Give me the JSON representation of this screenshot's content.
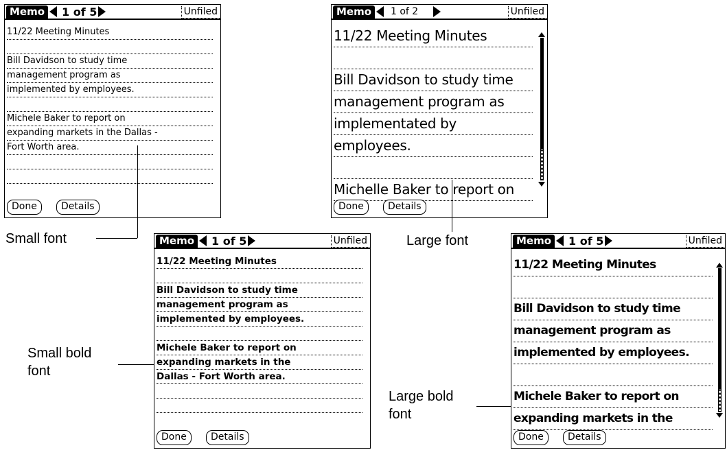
{
  "screens": {
    "small": {
      "title": "Memo",
      "page": "1 of 5",
      "category": "Unfiled",
      "lines": [
        "11/22 Meeting Minutes",
        "",
        "Bill Davidson to study time",
        "management program as",
        "implemented by employees.",
        "",
        "Michele Baker to report on",
        "expanding markets in the Dallas -",
        "Fort Worth area.",
        "",
        ""
      ],
      "done": "Done",
      "details": "Details"
    },
    "large": {
      "title": "Memo",
      "page": "1 of 2",
      "category": "Unfiled",
      "lines": [
        "11/22 Meeting Minutes",
        "",
        "Bill Davidson to study time",
        "management program as",
        "implementated by",
        "employees.",
        "",
        "Michelle Baker to report on"
      ],
      "done": "Done",
      "details": "Details"
    },
    "small_bold": {
      "title": "Memo",
      "page": "1 of 5",
      "category": "Unfiled",
      "lines": [
        "11/22 Meeting Minutes",
        "",
        "Bill Davidson to study time",
        "management program as",
        "implemented by employees.",
        "",
        "Michele Baker to report on",
        "expanding markets in the",
        "Dallas - Fort Worth area.",
        "",
        ""
      ],
      "done": "Done",
      "details": "Details"
    },
    "large_bold": {
      "title": "Memo",
      "page": "1 of 5",
      "category": "Unfiled",
      "lines": [
        "11/22 Meeting Minutes",
        "",
        "Bill Davidson to study time",
        "management program as",
        "implemented by employees.",
        "",
        "Michele Baker to report on",
        "expanding markets in the"
      ],
      "done": "Done",
      "details": "Details"
    }
  },
  "captions": {
    "small": "Small font",
    "large": "Large font",
    "small_bold_1": "Small bold",
    "small_bold_2": "font",
    "large_bold_1": "Large bold",
    "large_bold_2": "font"
  }
}
